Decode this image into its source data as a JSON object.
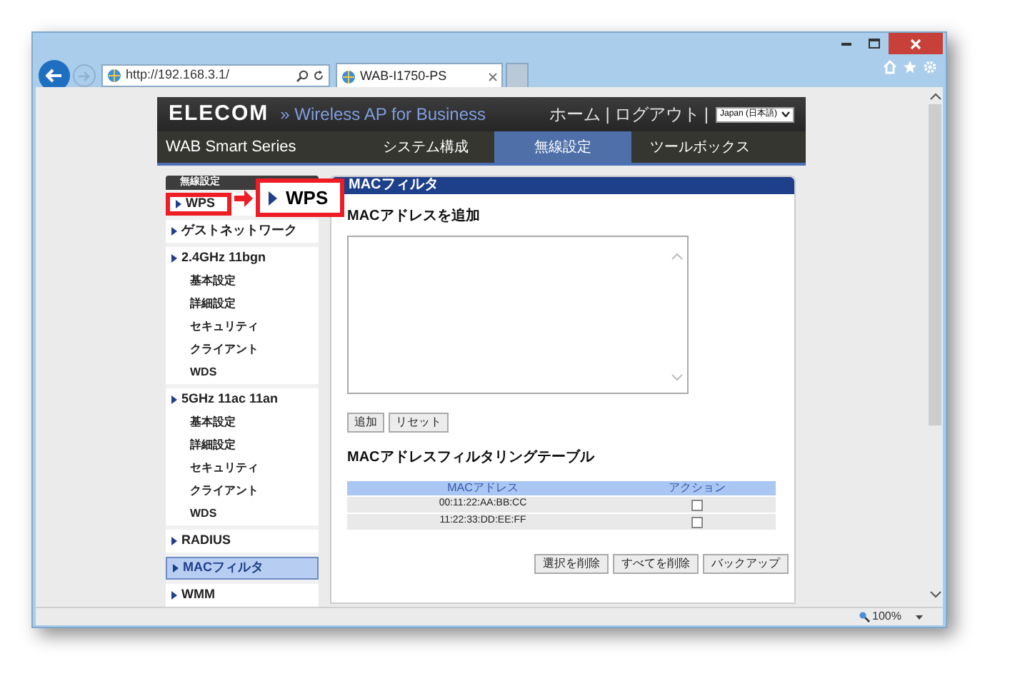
{
  "browser": {
    "address": "http://192.168.3.1/",
    "tab_title": "WAB-I1750-PS",
    "zoom": "100%"
  },
  "header": {
    "logo": "ELECOM",
    "tagline": "» Wireless AP for Business",
    "links": [
      "ホーム",
      "ログアウト"
    ],
    "separator": "|",
    "language": "Japan (日本語)"
  },
  "nav": {
    "series": "WAB Smart Series",
    "tabs": [
      {
        "label": "システム構成",
        "selected": false
      },
      {
        "label": "無線設定",
        "selected": true
      },
      {
        "label": "ツールボックス",
        "selected": false
      }
    ]
  },
  "sidebar": {
    "title": "無線設定",
    "items": [
      {
        "label": "WPS",
        "selected": false,
        "highlighted": true
      },
      {
        "label": "ゲストネットワーク",
        "selected": false,
        "highlighted": false
      },
      {
        "label": "2.4GHz 11bgn",
        "selected": false,
        "highlighted": false,
        "children": [
          {
            "label": "基本設定"
          },
          {
            "label": "詳細設定"
          },
          {
            "label": "セキュリティ"
          },
          {
            "label": "クライアント"
          },
          {
            "label": "WDS"
          }
        ]
      },
      {
        "label": "5GHz 11ac 11an",
        "selected": false,
        "highlighted": false,
        "children": [
          {
            "label": "基本設定"
          },
          {
            "label": "詳細設定"
          },
          {
            "label": "セキュリティ"
          },
          {
            "label": "クライアント"
          },
          {
            "label": "WDS"
          }
        ]
      },
      {
        "label": "RADIUS",
        "selected": false,
        "highlighted": false
      },
      {
        "label": "MACフィルタ",
        "selected": true,
        "highlighted": false
      },
      {
        "label": "WMM",
        "selected": false,
        "highlighted": false
      }
    ]
  },
  "callout": {
    "text": "WPS"
  },
  "panel": {
    "title": "MACフィルタ",
    "add_heading": "MACアドレスを追加",
    "add_buttons": [
      "追加",
      "リセット"
    ],
    "table_heading": "MACアドレスフィルタリングテーブル",
    "columns": [
      "MACアドレス",
      "アクション"
    ],
    "rows": [
      {
        "mac": "00:11:22:AA:BB:CC",
        "checked": false
      },
      {
        "mac": "11:22:33:DD:EE:FF",
        "checked": false
      }
    ],
    "buttons": [
      "選択を削除",
      "すべてを削除",
      "バックアップ"
    ]
  }
}
